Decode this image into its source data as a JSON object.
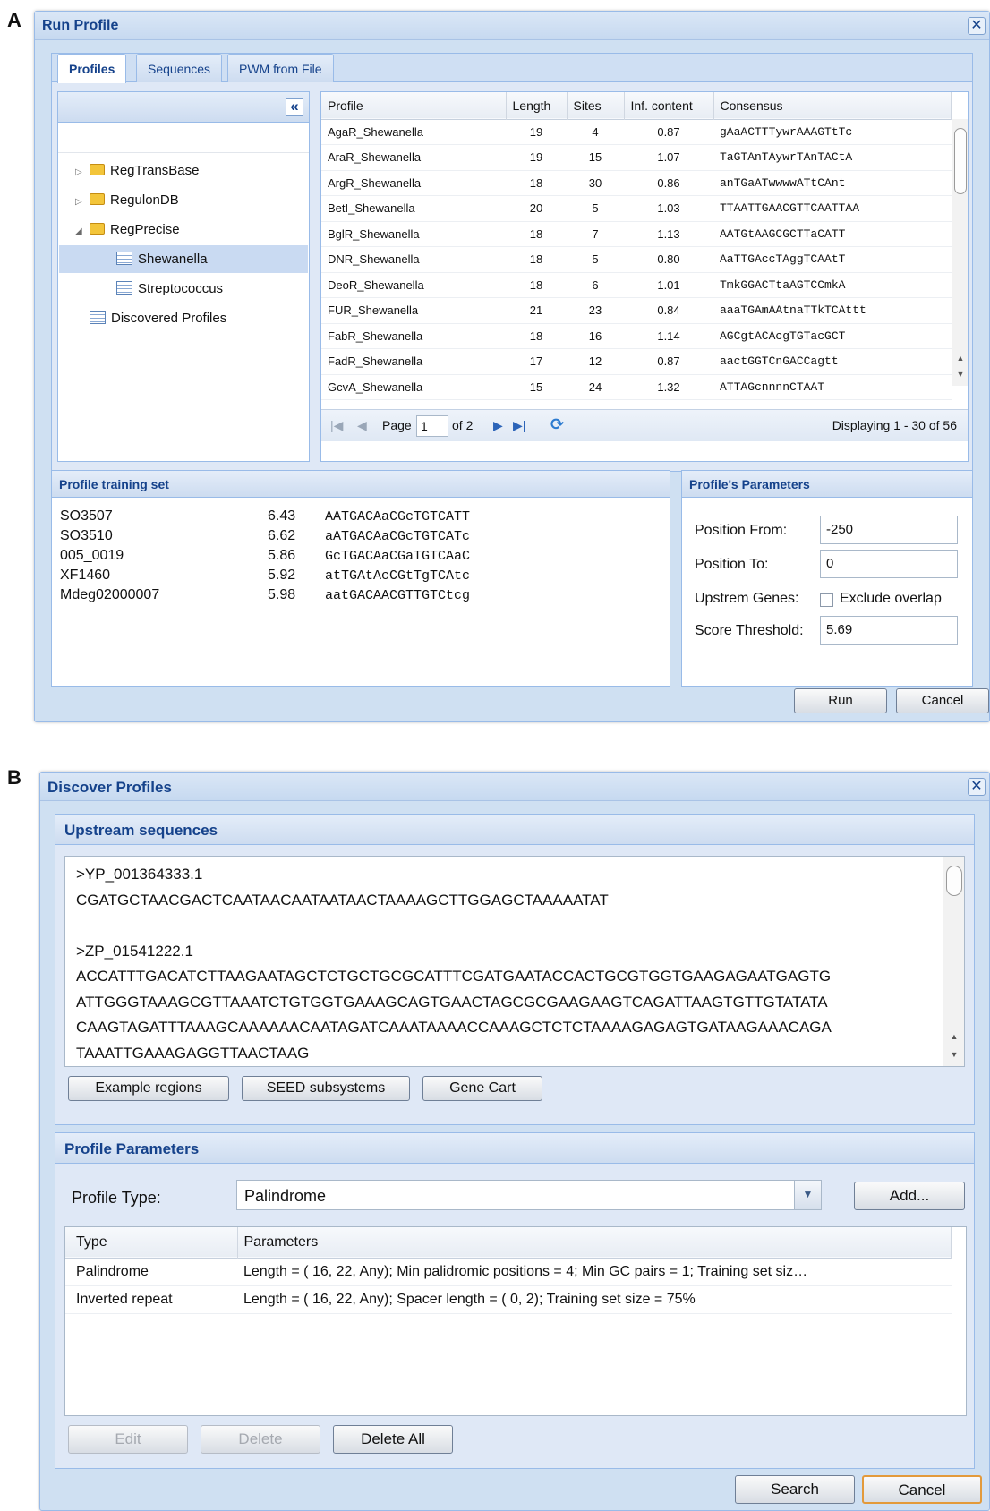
{
  "panel_a_letter": "A",
  "panel_b_letter": "B",
  "run_profile": {
    "title": "Run Profile",
    "close_glyph": "✕",
    "tabs": [
      "Profiles",
      "Sequences",
      "PWM from File"
    ],
    "collapse_glyph": "«",
    "tree": [
      {
        "label": "RegTransBase",
        "level": 0,
        "icon": "folder-icon",
        "expander": "collapsed"
      },
      {
        "label": "RegulonDB",
        "level": 0,
        "icon": "folder-icon",
        "expander": "collapsed"
      },
      {
        "label": "RegPrecise",
        "level": 0,
        "icon": "folder-icon",
        "expander": "expanded"
      },
      {
        "label": "Shewanella",
        "level": 1,
        "icon": "list-icon",
        "selected": true
      },
      {
        "label": "Streptococcus",
        "level": 1,
        "icon": "list-icon"
      },
      {
        "label": "Discovered Profiles",
        "level": 0,
        "icon": "list-icon"
      }
    ],
    "columns": [
      "Profile",
      "Length",
      "Sites",
      "Inf. content",
      "Consensus"
    ],
    "rows": [
      [
        "AgaR_Shewanella",
        "19",
        "4",
        "0.87",
        "gAaACTTTywrAAAGTtTc"
      ],
      [
        "AraR_Shewanella",
        "19",
        "15",
        "1.07",
        "TaGTAnTAywrTAnTACtA"
      ],
      [
        "ArgR_Shewanella",
        "18",
        "30",
        "0.86",
        "anTGaATwwwwATtCAnt"
      ],
      [
        "BetI_Shewanella",
        "20",
        "5",
        "1.03",
        "TTAATTGAACGTTCAATTAA"
      ],
      [
        "BglR_Shewanella",
        "18",
        "7",
        "1.13",
        "AATGtAAGCGCTTaCATT"
      ],
      [
        "DNR_Shewanella",
        "18",
        "5",
        "0.80",
        "AaTTGAccTAggTCAAtT"
      ],
      [
        "DeoR_Shewanella",
        "18",
        "6",
        "1.01",
        "TmkGGACTtaAGTCCmkA"
      ],
      [
        "FUR_Shewanella",
        "21",
        "23",
        "0.84",
        "aaaTGAmAAtnaTTkTCAttt"
      ],
      [
        "FabR_Shewanella",
        "18",
        "16",
        "1.14",
        "AGCgtACAcgTGTacGCT"
      ],
      [
        "FadR_Shewanella",
        "17",
        "12",
        "0.87",
        "aactGGTCnGACCagtt"
      ],
      [
        "GcvA_Shewanella",
        "15",
        "24",
        "1.32",
        "ATTAGcnnnnCTAAT"
      ]
    ],
    "pager": {
      "page_label": "Page",
      "page_value": "1",
      "of_label": "of 2",
      "display": "Displaying 1 - 30 of 56"
    },
    "training_title": "Profile training set",
    "training": [
      [
        "SO3507",
        "6.43",
        "AATGACAaCGcTGTCATT"
      ],
      [
        "SO3510",
        "6.62",
        "aATGACAaCGcTGTCATc"
      ],
      [
        "005_0019",
        "5.86",
        "GcTGACAaCGaTGTCAaC"
      ],
      [
        "XF1460",
        "5.92",
        "atTGAtAcCGtTgTCAtc"
      ],
      [
        "Mdeg02000007",
        "5.98",
        "aatGACAACGTTGTCtcg"
      ]
    ],
    "params_title": "Profile's Parameters",
    "params": {
      "pos_from_label": "Position From:",
      "pos_from_value": "-250",
      "pos_to_label": "Position To:",
      "pos_to_value": "0",
      "upstream_label": "Upstrem Genes:",
      "exclude_label": "Exclude overlap",
      "exclude_checked": false,
      "threshold_label": "Score Threshold:",
      "threshold_value": "5.69"
    },
    "run_label": "Run",
    "cancel_label": "Cancel"
  },
  "discover_profiles": {
    "title": "Discover Profiles",
    "close_glyph": "✕",
    "upstream_title": "Upstream sequences",
    "seq_lines": [
      ">YP_001364333.1",
      "CGATGCTAACGACTCAATAACAATAATAACTAAAAGCTTGGAGCTAAAAATAT",
      "",
      ">ZP_01541222.1",
      "ACCATTTGACATCTTAAGAATAGCTCTGCTGCGCATTTCGATGAATACCACTGCGTGGTGAAGAGAATGAGTG",
      "ATTGGGTAAAGCGTTAAATCTGTGGTGAAAGCAGTGAACTAGCGCGAAGAAGTCAGATTAAGTGTTGTATATA",
      "CAAGTAGATTTAAAGCAAAAAACAATAGATCAAATAAAACCAAAGCTCTCTAAAAGAGAGTGATAAGAAACAGA",
      "TAAATTGAAAGAGGTTAACTAAG"
    ],
    "seq_buttons": [
      "Example regions",
      "SEED subsystems",
      "Gene Cart"
    ],
    "params_title": "Profile Parameters",
    "type_label": "Profile Type:",
    "type_value": "Palindrome",
    "add_label": "Add...",
    "columns": [
      "Type",
      "Parameters"
    ],
    "rows": [
      [
        "Palindrome",
        "Length = ( 16, 22, Any); Min palidromic positions = 4; Min GC pairs = 1; Training set siz…"
      ],
      [
        "Inverted repeat",
        "Length = ( 16, 22, Any); Spacer length = ( 0, 2); Training set size = 75%"
      ]
    ],
    "edit_label": "Edit",
    "delete_label": "Delete",
    "delete_all_label": "Delete All",
    "search_label": "Search",
    "cancel_label": "Cancel"
  }
}
